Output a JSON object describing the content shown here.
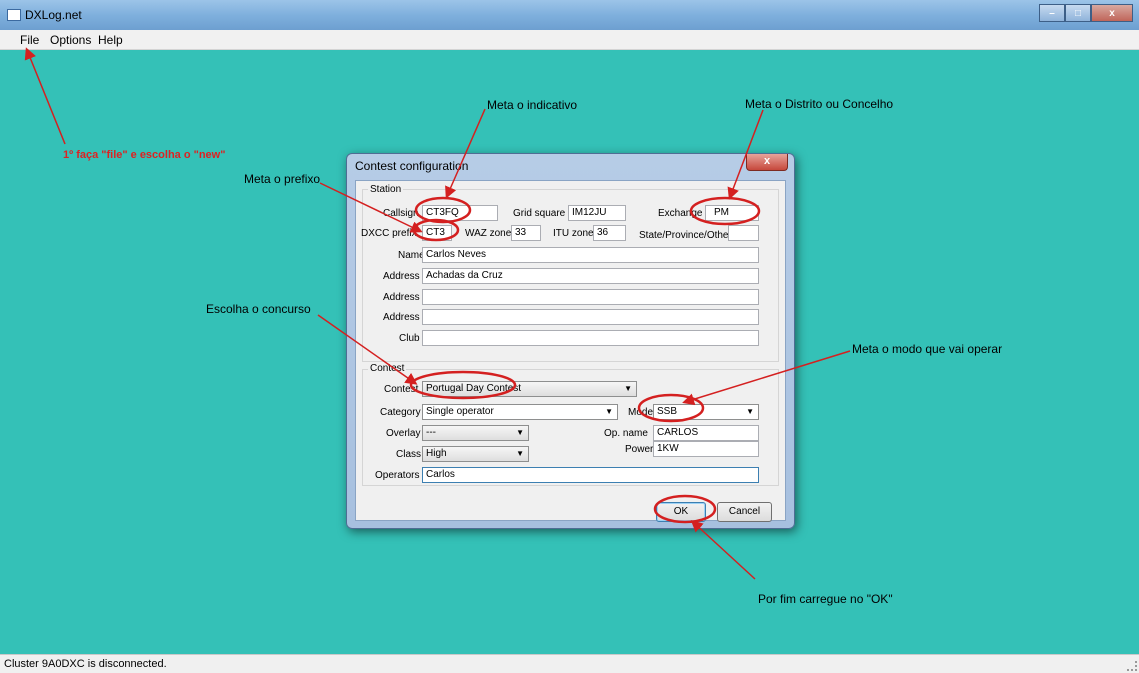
{
  "window": {
    "title": "DXLog.net",
    "controls": [
      "–",
      "□",
      "x"
    ]
  },
  "menu": {
    "items": [
      "File",
      "Options",
      "Help"
    ]
  },
  "status": {
    "text": "Cluster 9A0DXC is disconnected."
  },
  "dialog": {
    "title": "Contest configuration",
    "close_label": "x",
    "station": {
      "group_label": "Station",
      "callsign_label": "Callsign",
      "callsign": "CT3FQ",
      "grid_label": "Grid square",
      "grid": "IM12JU",
      "exchange_label": "Exchange",
      "exchange": "PM",
      "dxcc_label": "DXCC prefix",
      "dxcc": "CT3",
      "waz_label": "WAZ zone",
      "waz": "33",
      "itu_label": "ITU zone",
      "itu": "36",
      "state_label": "State/Province/Other",
      "state": "",
      "name_label": "Name",
      "name": "Carlos Neves",
      "address_label": "Address",
      "address1": "Achadas da Cruz",
      "address2": "",
      "address3": "",
      "club_label": "Club",
      "club": ""
    },
    "contest": {
      "group_label": "Contest",
      "contest_label": "Contest",
      "contest": "Portugal Day Contest",
      "category_label": "Category",
      "category": "Single operator",
      "mode_label": "Mode",
      "mode": "SSB",
      "overlay_label": "Overlay",
      "overlay": "---",
      "opname_label": "Op. name",
      "opname": "CARLOS",
      "class_label": "Class",
      "class": "High",
      "power_label": "Power",
      "power": "1KW",
      "operators_label": "Operators",
      "operators": "Carlos"
    },
    "ok_label": "OK",
    "cancel_label": "Cancel"
  },
  "annotations": {
    "file_new": "1º faça \"file\" e escolha o \"new\"",
    "indicativo": "Meta o indicativo",
    "distrito": "Meta o Distrito ou Concelho",
    "prefixo": "Meta o prefixo",
    "concurso": "Escolha o concurso",
    "modo": "Meta o modo que vai operar",
    "ok": "Por fim carregue no \"OK\""
  },
  "colors": {
    "desktop": "#34c1b7",
    "annotation": "#d42020"
  }
}
